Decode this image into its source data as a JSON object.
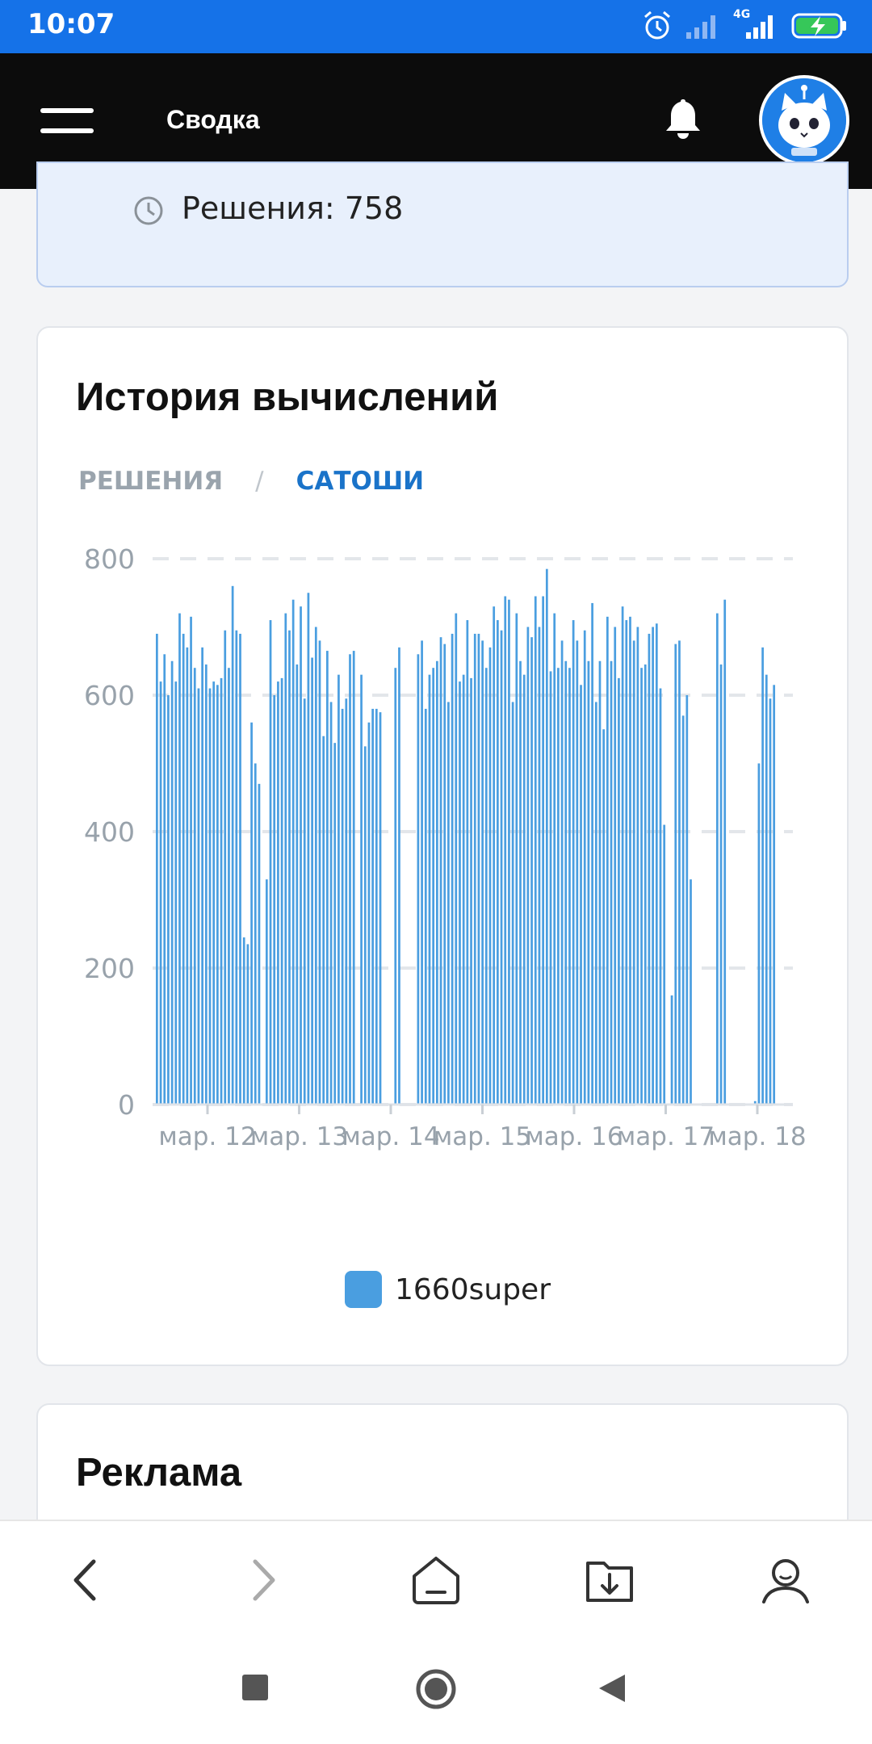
{
  "status_bar": {
    "time": "10:07",
    "network_label": "4G",
    "icons": [
      "alarm-icon",
      "signal-icon",
      "signal-4g-icon",
      "battery-charging-icon"
    ]
  },
  "app_bar": {
    "title": "Сводка",
    "icons": [
      "menu-icon",
      "bell-icon",
      "avatar-cat"
    ]
  },
  "info_card": {
    "solutions_text": "Решения: 758",
    "icon": "clock-icon"
  },
  "history_card": {
    "title": "История вычислений",
    "tabs": [
      {
        "label": "РЕШЕНИЯ",
        "active": false
      },
      {
        "label": "САТОШИ",
        "active": true
      }
    ],
    "separator": "/"
  },
  "chart_data": {
    "type": "bar",
    "title": "",
    "xlabel": "",
    "ylabel": "",
    "ylim": [
      0,
      800
    ],
    "yticks": [
      0,
      200,
      400,
      600,
      800
    ],
    "grid": true,
    "legend_position": "bottom-center",
    "x_tick_labels": [
      "мар. 12",
      "мар. 13",
      "мар. 14",
      "мар. 15",
      "мар. 16",
      "мар. 17",
      "мар. 18"
    ],
    "series": [
      {
        "name": "1660super",
        "color": "#4a9ee0",
        "values": [
          690,
          620,
          660,
          600,
          650,
          620,
          720,
          690,
          670,
          715,
          640,
          610,
          670,
          645,
          610,
          620,
          615,
          625,
          695,
          640,
          760,
          695,
          690,
          245,
          235,
          560,
          500,
          470,
          0,
          330,
          710,
          600,
          620,
          625,
          720,
          695,
          740,
          645,
          730,
          595,
          750,
          655,
          700,
          680,
          540,
          665,
          590,
          530,
          630,
          580,
          595,
          660,
          665,
          0,
          630,
          525,
          560,
          580,
          580,
          575,
          0,
          0,
          0,
          640,
          670,
          0,
          0,
          0,
          0,
          660,
          680,
          580,
          630,
          640,
          650,
          685,
          675,
          590,
          690,
          720,
          620,
          630,
          710,
          625,
          690,
          690,
          680,
          640,
          670,
          730,
          710,
          695,
          745,
          740,
          590,
          720,
          650,
          630,
          700,
          685,
          745,
          700,
          745,
          785,
          635,
          720,
          640,
          680,
          650,
          640,
          710,
          680,
          615,
          695,
          650,
          735,
          590,
          650,
          550,
          715,
          650,
          700,
          625,
          730,
          710,
          715,
          680,
          700,
          640,
          645,
          690,
          700,
          705,
          610,
          410,
          0,
          160,
          675,
          680,
          570,
          600,
          330,
          0,
          0,
          0,
          0,
          0,
          0,
          720,
          645,
          740,
          0,
          0,
          0,
          0,
          0,
          0,
          0,
          5,
          500,
          670,
          630,
          595,
          615
        ]
      }
    ]
  },
  "ad_card": {
    "title": "Реклама"
  },
  "browser_bar": {
    "icons": [
      "back-icon",
      "forward-icon",
      "home-icon",
      "downloads-icon",
      "profile-icon"
    ]
  },
  "system_nav": {
    "icons": [
      "recents-icon",
      "home-circle-icon",
      "back-triangle-icon"
    ]
  },
  "colors": {
    "status_bar": "#1572e8",
    "app_bar": "#0c0c0c",
    "bar": "#4a9ee0",
    "active_tab": "#1a73c9"
  }
}
